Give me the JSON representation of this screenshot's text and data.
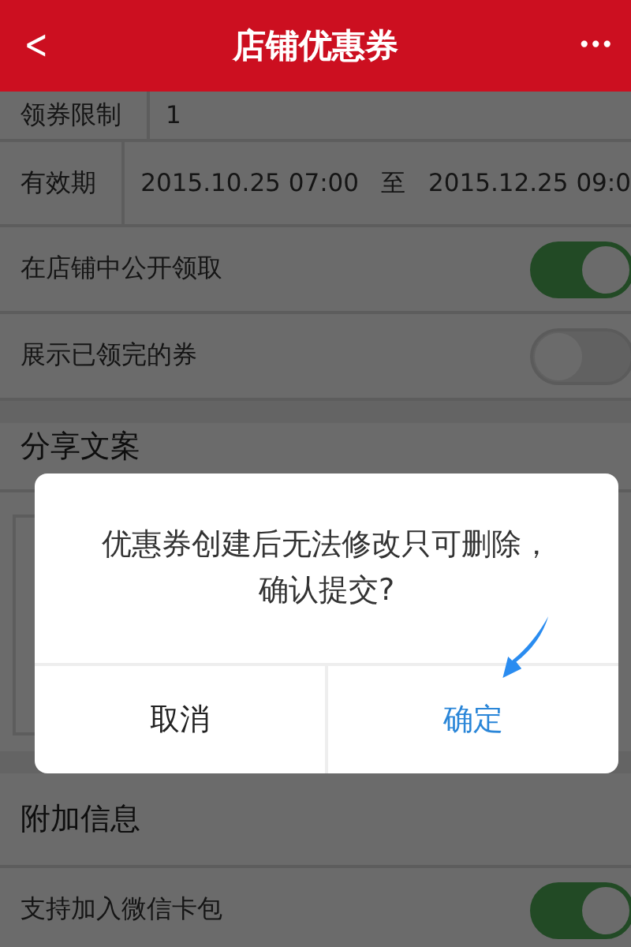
{
  "header": {
    "back": "<",
    "title": "店铺优惠券",
    "more": "•••"
  },
  "fields": [
    {
      "label": "领券限制",
      "value": "1"
    },
    {
      "label": "有效期",
      "start": "2015.10.25 07:00",
      "separator": "至",
      "end": "2015.12.25 09:0"
    }
  ],
  "toggles": [
    {
      "label": "在店铺中公开领取",
      "on": true
    },
    {
      "label": "展示已领完的券",
      "on": false
    }
  ],
  "share_section": {
    "title": "分享文案"
  },
  "extra_section": {
    "title": "附加信息",
    "toggles": [
      {
        "label": "支持加入微信卡包",
        "on": true
      }
    ]
  },
  "dialog": {
    "message": "优惠券创建后无法修改只可删除，确认提交?",
    "buttons": [
      {
        "label": "取消",
        "kind": "cancel"
      },
      {
        "label": "确定",
        "kind": "confirm"
      }
    ]
  }
}
